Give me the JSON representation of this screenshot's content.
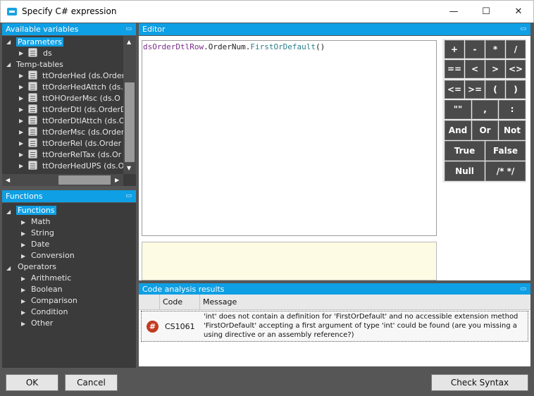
{
  "window": {
    "title": "Specify C# expression",
    "min": "—",
    "max": "☐",
    "close": "✕"
  },
  "variables_panel": {
    "title": "Available variables",
    "parameters_label": "Parameters",
    "ds_label": "ds",
    "temp_tables_label": "Temp-tables",
    "tables": [
      "ttOrderHed (ds.Order",
      "ttOrderHedAttch (ds.",
      "ttOHOrderMsc (ds.O",
      "ttOrderDtl (ds.OrderD",
      "ttOrderDtlAttch (ds.Or",
      "ttOrderMsc (ds.Order",
      "ttOrderRel (ds.Order",
      "ttOrderRelTax (ds.Or",
      "ttOrderHedUPS (ds.O"
    ]
  },
  "functions_panel": {
    "title": "Functions",
    "functions_label": "Functions",
    "function_items": [
      "Math",
      "String",
      "Date",
      "Conversion"
    ],
    "operators_label": "Operators",
    "operator_items": [
      "Arithmetic",
      "Boolean",
      "Comparison",
      "Condition",
      "Other"
    ]
  },
  "editor": {
    "title": "Editor",
    "code_var": "dsOrderDtlRow",
    "code_dot1": ".",
    "code_member": "OrderNum",
    "code_dot2": ".",
    "code_method": "FirstOrDefault",
    "code_parens": "()"
  },
  "keypad": {
    "row1": [
      "+",
      "-",
      "*",
      "/"
    ],
    "row2": [
      "==",
      "<",
      ">",
      "<>"
    ],
    "row3": [
      "<=",
      ">=",
      "(",
      ")"
    ],
    "row4": [
      "\"\"",
      ",",
      ":"
    ],
    "row5": [
      "And",
      "Or",
      "Not"
    ],
    "row6": [
      "True",
      "False"
    ],
    "row7": [
      "Null",
      "/* */"
    ]
  },
  "analysis": {
    "title": "Code analysis results",
    "col_code": "Code",
    "col_message": "Message",
    "error_symbol": "#",
    "row_code": "CS1061",
    "row_message_1": "'int' does not contain a definition for 'FirstOrDefault' and no accessible extension method",
    "row_message_2": "'FirstOrDefault' accepting a first argument of type 'int' could be found (are you missing a",
    "row_message_3": "using directive or an assembly reference?)"
  },
  "buttons": {
    "ok": "OK",
    "cancel": "Cancel",
    "check_syntax": "Check Syntax"
  },
  "colors": {
    "accent": "#0f9fe4",
    "panel_bg": "#3b3b3b",
    "frame_bg": "#565656",
    "error": "#c23b21"
  }
}
